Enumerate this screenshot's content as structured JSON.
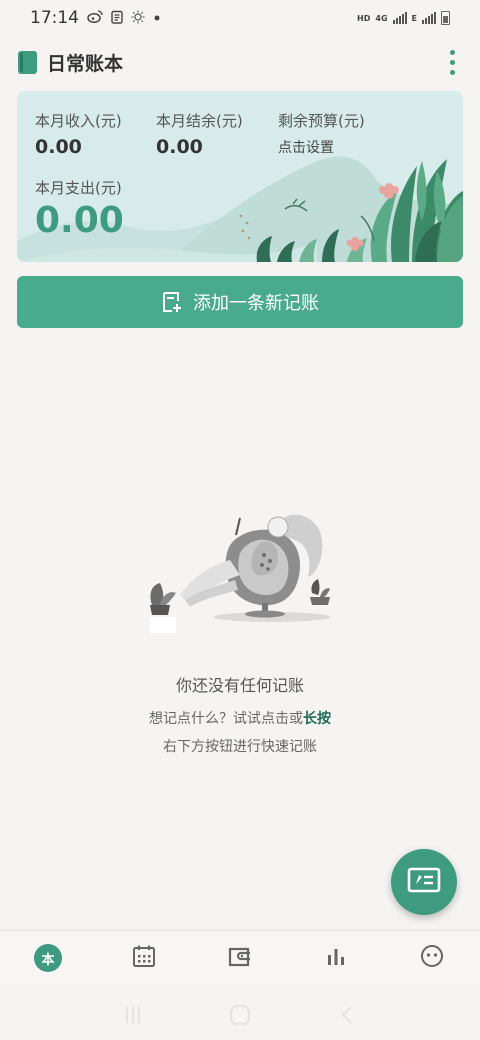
{
  "status_bar": {
    "time": "17:14",
    "left_icons": [
      "weibo-icon",
      "clipboard-icon",
      "brightness-icon",
      "dot-icon"
    ],
    "network_labels": [
      "HD",
      "4G",
      "E"
    ],
    "battery": "battery-icon"
  },
  "header": {
    "title": "日常账本",
    "menu_icon": "more-vertical-icon"
  },
  "summary": {
    "income_label": "本月收入(元)",
    "income_value": "0.00",
    "balance_label": "本月结余(元)",
    "balance_value": "0.00",
    "budget_label": "剩余预算(元)",
    "budget_action": "点击设置",
    "expense_label": "本月支出(元)",
    "expense_value": "0.00"
  },
  "add_button": {
    "label": "添加一条新记账",
    "icon": "note-add-icon"
  },
  "empty_state": {
    "title": "你还没有任何记账",
    "hint_prefix": "想记点什么？试试点击或",
    "hint_strong": "长按",
    "hint_line2": "右下方按钮进行快速记账"
  },
  "fab": {
    "icon": "quick-note-icon"
  },
  "bottom_nav": {
    "items": [
      {
        "name": "home",
        "glyph": "本",
        "icon": "home-book-icon",
        "active": true
      },
      {
        "name": "calendar",
        "icon": "calendar-icon",
        "active": false
      },
      {
        "name": "wallet",
        "icon": "wallet-icon",
        "active": false
      },
      {
        "name": "stats",
        "icon": "bar-chart-icon",
        "active": false
      },
      {
        "name": "profile",
        "icon": "smiley-icon",
        "active": false
      }
    ]
  },
  "colors": {
    "accent": "#3e9b80",
    "button": "#4aaa8e",
    "card_bg": "#d7ecea",
    "page_bg": "#f5f4f2"
  }
}
